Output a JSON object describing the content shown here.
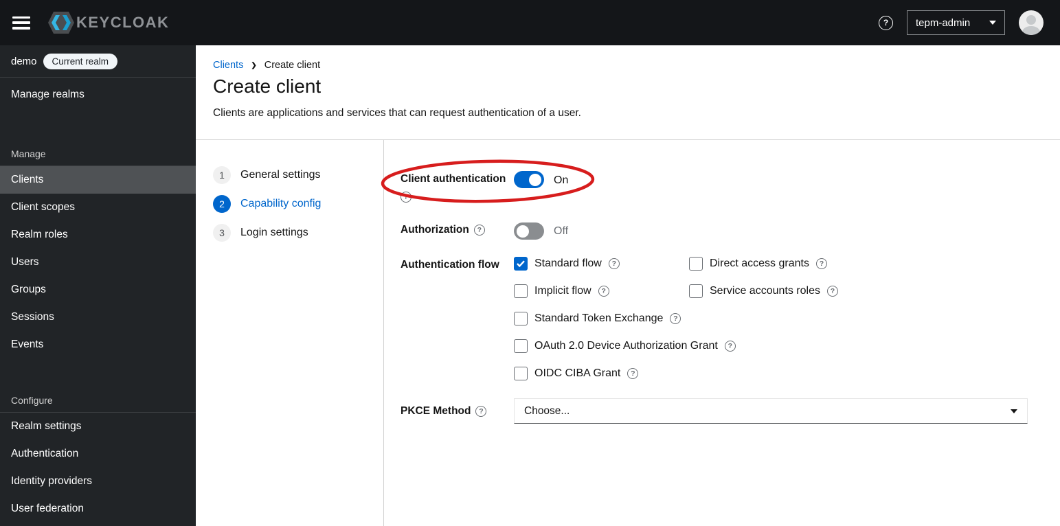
{
  "topbar": {
    "brand": "KEYCLOAK",
    "user": "tepm-admin"
  },
  "sidebar": {
    "realm": {
      "name": "demo",
      "badge": "Current realm"
    },
    "manage_realms": "Manage realms",
    "sections": [
      {
        "title": "Manage",
        "items": [
          {
            "label": "Clients",
            "selected": true
          },
          {
            "label": "Client scopes",
            "selected": false
          },
          {
            "label": "Realm roles",
            "selected": false
          },
          {
            "label": "Users",
            "selected": false
          },
          {
            "label": "Groups",
            "selected": false
          },
          {
            "label": "Sessions",
            "selected": false
          },
          {
            "label": "Events",
            "selected": false
          }
        ]
      },
      {
        "title": "Configure",
        "items": [
          {
            "label": "Realm settings",
            "selected": false
          },
          {
            "label": "Authentication",
            "selected": false
          },
          {
            "label": "Identity providers",
            "selected": false
          },
          {
            "label": "User federation",
            "selected": false
          }
        ]
      }
    ]
  },
  "breadcrumb": {
    "link": "Clients",
    "current": "Create client"
  },
  "page": {
    "title": "Create client",
    "subtitle": "Clients are applications and services that can request authentication of a user."
  },
  "wizard": {
    "steps": [
      {
        "num": "1",
        "label": "General settings",
        "active": false
      },
      {
        "num": "2",
        "label": "Capability config",
        "active": true
      },
      {
        "num": "3",
        "label": "Login settings",
        "active": false
      }
    ]
  },
  "form": {
    "client_auth": {
      "label": "Client authentication",
      "state": "On"
    },
    "authorization": {
      "label": "Authorization",
      "state": "Off"
    },
    "auth_flow": {
      "label": "Authentication flow",
      "col1": [
        {
          "label": "Standard flow",
          "checked": true
        },
        {
          "label": "Implicit flow",
          "checked": false
        },
        {
          "label": "Standard Token Exchange",
          "checked": false
        },
        {
          "label": "OAuth 2.0 Device Authorization Grant",
          "checked": false
        },
        {
          "label": "OIDC CIBA Grant",
          "checked": false
        }
      ],
      "col2": [
        {
          "label": "Direct access grants",
          "checked": false
        },
        {
          "label": "Service accounts roles",
          "checked": false
        }
      ]
    },
    "pkce": {
      "label": "PKCE Method",
      "value": "Choose..."
    }
  },
  "colors": {
    "accent": "#0066cc",
    "annotation_red": "#d71d1d"
  }
}
